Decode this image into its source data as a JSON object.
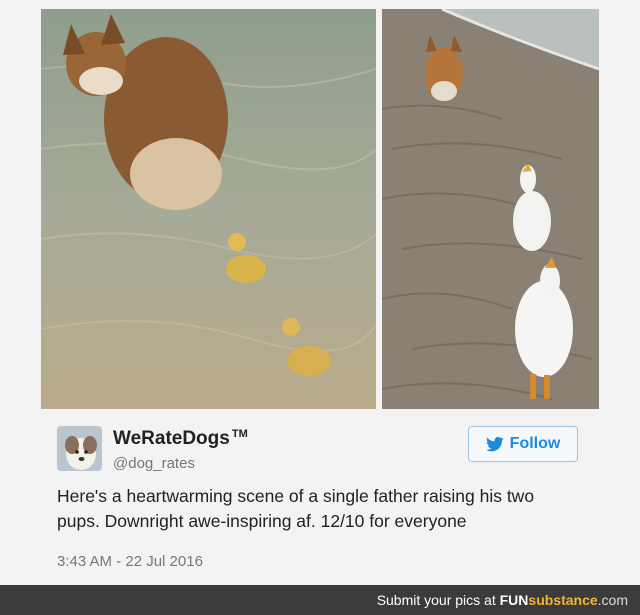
{
  "photos": {
    "left_alt": "corgi-leading-ducklings-in-water",
    "right_alt": "corgi-leading-ducks-on-beach"
  },
  "tweet": {
    "display_name": "WeRateDogs",
    "trademark": "TM",
    "handle": "@dog_rates",
    "follow_label": "Follow",
    "text": "Here's a heartwarming scene of a single father raising his two pups. Downright awe-inspiring af. 12/10 for everyone",
    "timestamp": "3:43 AM - 22 Jul 2016"
  },
  "footer": {
    "prefix": "Submit your pics at ",
    "brand_fun": "FUN",
    "brand_sub": "substance",
    "brand_rest": ".com"
  },
  "colors": {
    "follow_blue": "#1d8ae0",
    "footer_bg": "#3b3b3b",
    "brand_accent": "#f2b632"
  },
  "icons": {
    "follow": "twitter-bird-icon"
  }
}
